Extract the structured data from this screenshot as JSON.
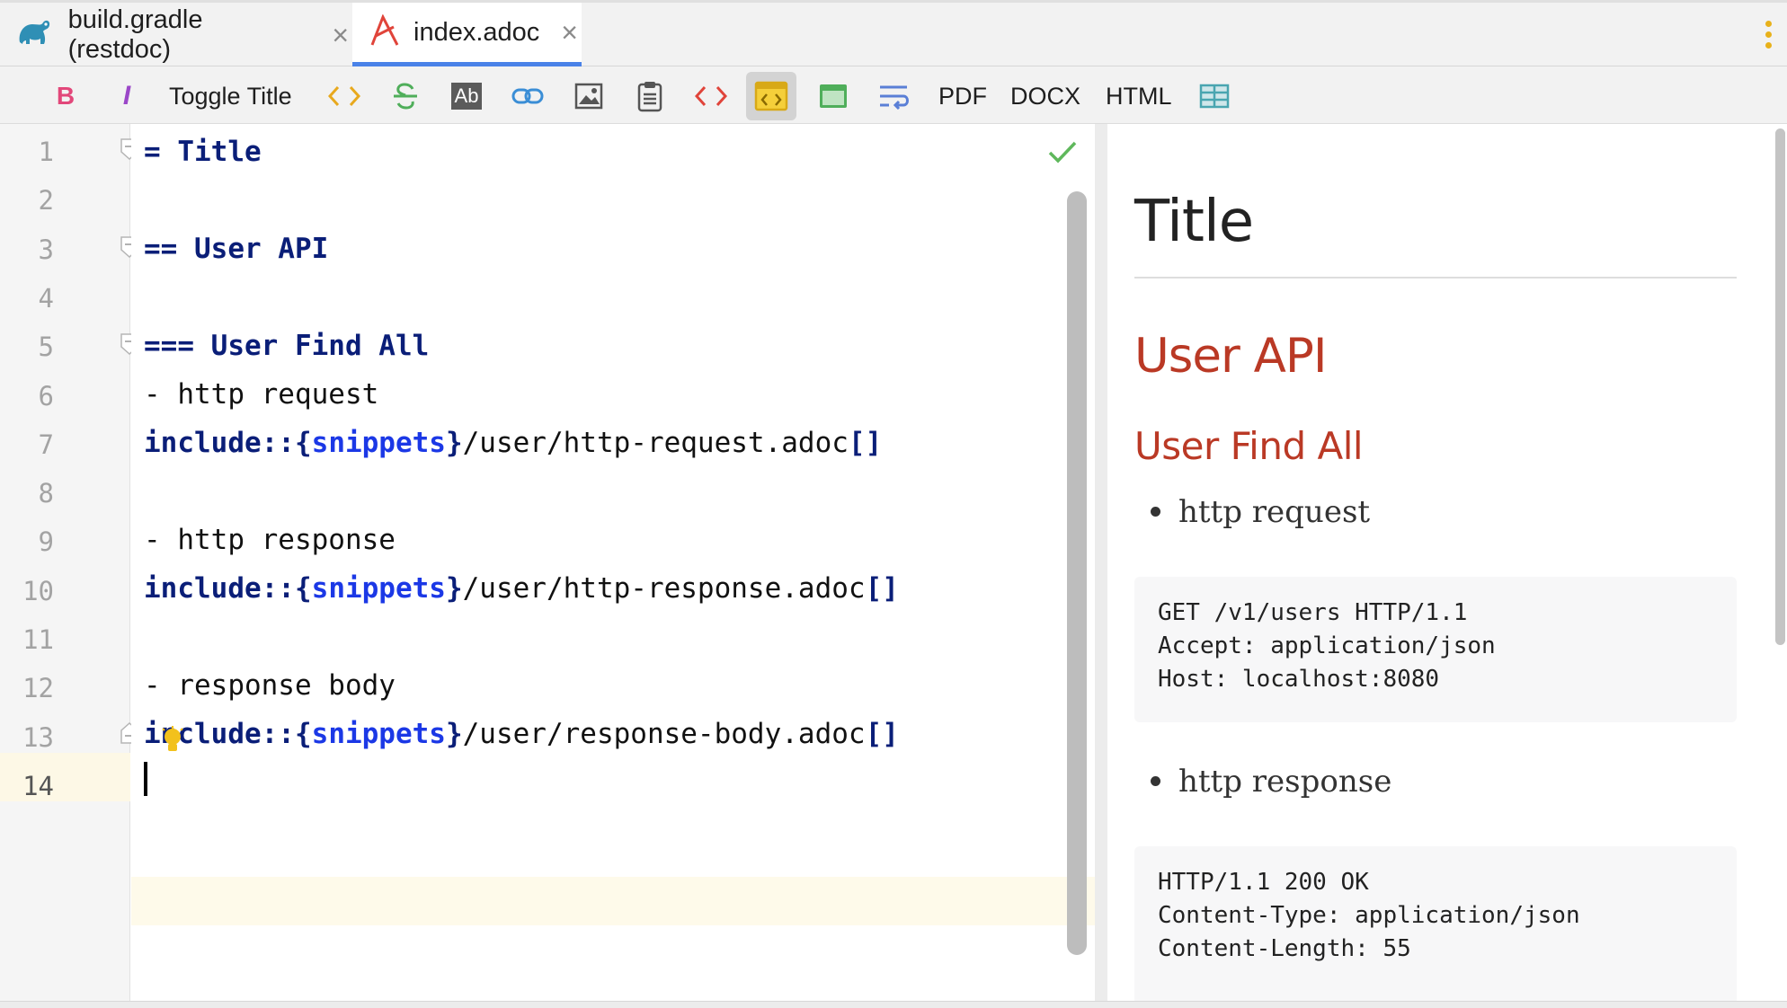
{
  "tabs": [
    {
      "label": "build.gradle (restdoc)",
      "icon": "gradle-elephant-icon",
      "active": false
    },
    {
      "label": "index.adoc",
      "icon": "asciidoc-icon",
      "active": true
    }
  ],
  "toolbar": {
    "toggle_title": "Toggle Title",
    "pdf": "PDF",
    "docx": "DOCX",
    "html": "HTML",
    "text_icon": "Ab",
    "bold_glyph": "B",
    "italic_glyph": "I"
  },
  "editor": {
    "line_numbers": [
      "1",
      "2",
      "3",
      "4",
      "5",
      "6",
      "7",
      "8",
      "9",
      "10",
      "11",
      "12",
      "13",
      "14"
    ],
    "current_line": "14",
    "lines": {
      "l1": "= Title",
      "l3": "== User API",
      "l5": "=== User Find All",
      "l6": "- http request",
      "l9": "- http response",
      "l12": "- response body",
      "inc_kw": "include::",
      "snip_open": "{",
      "snip_attr": "snippets",
      "snip_close": "}",
      "l7_path": "/user/http-request.adoc",
      "l10_path": "/user/http-response.adoc",
      "l13_path": "/user/response-body.adoc",
      "brackets": "[]"
    }
  },
  "preview": {
    "title": "Title",
    "h2": "User API",
    "h3": "User Find All",
    "item1": "http request",
    "code1": "GET /v1/users HTTP/1.1\nAccept: application/json\nHost: localhost:8080",
    "item2": "http response",
    "code2": "HTTP/1.1 200 OK\nContent-Type: application/json\nContent-Length: 55"
  },
  "colors": {
    "heading_red": "#ba3925",
    "keyword_navy": "#0a1e78",
    "attribute_blue": "#1b38e6",
    "tab_underline": "#4a82e8"
  }
}
